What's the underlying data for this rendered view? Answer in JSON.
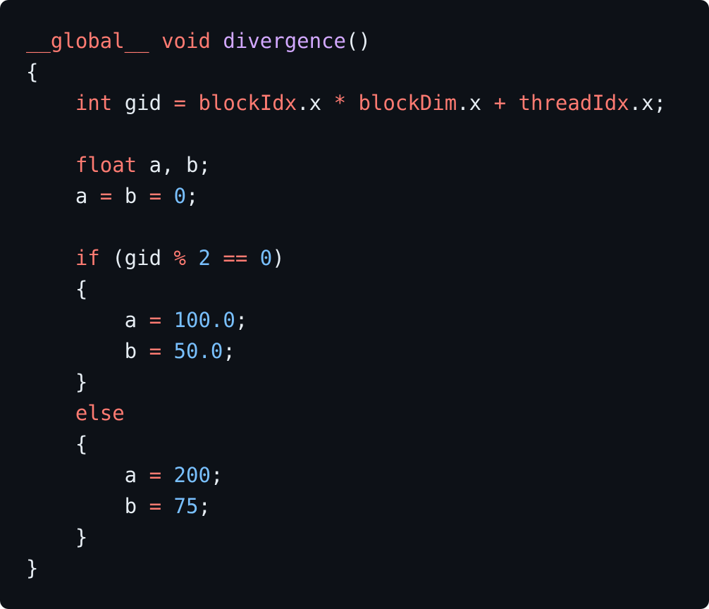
{
  "code": {
    "language": "cuda",
    "lines": [
      [
        {
          "t": "__global__",
          "k": "kw"
        },
        {
          "t": " ",
          "k": "plain"
        },
        {
          "t": "void",
          "k": "kw"
        },
        {
          "t": " ",
          "k": "plain"
        },
        {
          "t": "divergence",
          "k": "fn"
        },
        {
          "t": "()",
          "k": "plain"
        }
      ],
      [
        {
          "t": "{",
          "k": "plain"
        }
      ],
      [
        {
          "t": "    ",
          "k": "plain"
        },
        {
          "t": "int",
          "k": "kw"
        },
        {
          "t": " gid ",
          "k": "plain"
        },
        {
          "t": "=",
          "k": "op"
        },
        {
          "t": " ",
          "k": "plain"
        },
        {
          "t": "blockIdx",
          "k": "kw"
        },
        {
          "t": ".x ",
          "k": "plain"
        },
        {
          "t": "*",
          "k": "op"
        },
        {
          "t": " ",
          "k": "plain"
        },
        {
          "t": "blockDim",
          "k": "kw"
        },
        {
          "t": ".x ",
          "k": "plain"
        },
        {
          "t": "+",
          "k": "op"
        },
        {
          "t": " ",
          "k": "plain"
        },
        {
          "t": "threadIdx",
          "k": "kw"
        },
        {
          "t": ".x;",
          "k": "plain"
        }
      ],
      [],
      [
        {
          "t": "    ",
          "k": "plain"
        },
        {
          "t": "float",
          "k": "kw"
        },
        {
          "t": " a, b;",
          "k": "plain"
        }
      ],
      [
        {
          "t": "    a ",
          "k": "plain"
        },
        {
          "t": "=",
          "k": "op"
        },
        {
          "t": " b ",
          "k": "plain"
        },
        {
          "t": "=",
          "k": "op"
        },
        {
          "t": " ",
          "k": "plain"
        },
        {
          "t": "0",
          "k": "num"
        },
        {
          "t": ";",
          "k": "plain"
        }
      ],
      [],
      [
        {
          "t": "    ",
          "k": "plain"
        },
        {
          "t": "if",
          "k": "kw"
        },
        {
          "t": " (gid ",
          "k": "plain"
        },
        {
          "t": "%",
          "k": "op"
        },
        {
          "t": " ",
          "k": "plain"
        },
        {
          "t": "2",
          "k": "num"
        },
        {
          "t": " ",
          "k": "plain"
        },
        {
          "t": "==",
          "k": "op"
        },
        {
          "t": " ",
          "k": "plain"
        },
        {
          "t": "0",
          "k": "num"
        },
        {
          "t": ")",
          "k": "plain"
        }
      ],
      [
        {
          "t": "    {",
          "k": "plain"
        }
      ],
      [
        {
          "t": "        a ",
          "k": "plain"
        },
        {
          "t": "=",
          "k": "op"
        },
        {
          "t": " ",
          "k": "plain"
        },
        {
          "t": "100.0",
          "k": "num"
        },
        {
          "t": ";",
          "k": "plain"
        }
      ],
      [
        {
          "t": "        b ",
          "k": "plain"
        },
        {
          "t": "=",
          "k": "op"
        },
        {
          "t": " ",
          "k": "plain"
        },
        {
          "t": "50.0",
          "k": "num"
        },
        {
          "t": ";",
          "k": "plain"
        }
      ],
      [
        {
          "t": "    }",
          "k": "plain"
        }
      ],
      [
        {
          "t": "    ",
          "k": "plain"
        },
        {
          "t": "else",
          "k": "kw"
        }
      ],
      [
        {
          "t": "    {",
          "k": "plain"
        }
      ],
      [
        {
          "t": "        a ",
          "k": "plain"
        },
        {
          "t": "=",
          "k": "op"
        },
        {
          "t": " ",
          "k": "plain"
        },
        {
          "t": "200",
          "k": "num"
        },
        {
          "t": ";",
          "k": "plain"
        }
      ],
      [
        {
          "t": "        b ",
          "k": "plain"
        },
        {
          "t": "=",
          "k": "op"
        },
        {
          "t": " ",
          "k": "plain"
        },
        {
          "t": "75",
          "k": "num"
        },
        {
          "t": ";",
          "k": "plain"
        }
      ],
      [
        {
          "t": "    }",
          "k": "plain"
        }
      ],
      [
        {
          "t": "}",
          "k": "plain"
        }
      ]
    ]
  },
  "colors": {
    "background": "#0d1117",
    "keyword": "#ff7b72",
    "function": "#d2a8ff",
    "number": "#79c0ff",
    "text": "#e6edf3"
  }
}
